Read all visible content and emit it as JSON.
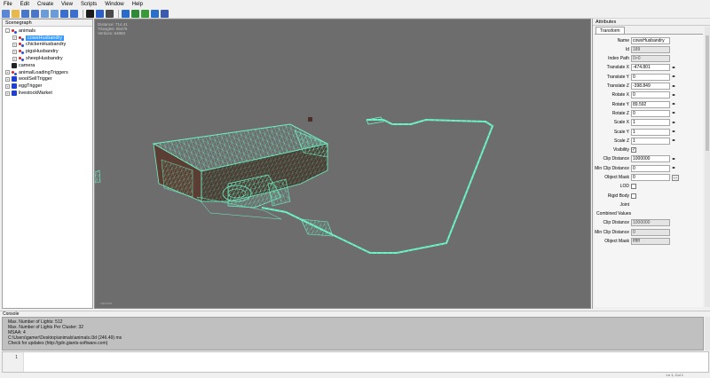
{
  "menu": [
    "File",
    "Edit",
    "Create",
    "View",
    "Scripts",
    "Window",
    "Help"
  ],
  "toolbar": {
    "icons": [
      "new-file-icon",
      "open-file-icon",
      "save-icon",
      "save-all-icon",
      "import-icon",
      "export-icon",
      "undo-icon",
      "redo-icon",
      "play-icon",
      "select-icon",
      "move-icon",
      "transform-icon",
      "terrain-icon",
      "grass-icon",
      "water-icon",
      "settings-icon"
    ],
    "colors": [
      "#5a86d6",
      "#e7b94c",
      "#4a76c8",
      "#4a76c8",
      "#6c9cd8",
      "#6c9cd8",
      "#3a6fd0",
      "#3a6fd0",
      "#1a1a1a",
      "#2a5fc8",
      "#4a4a4a",
      "#2a6ac8",
      "#2f8a3a",
      "#3a9a3a",
      "#2a70c8",
      "#3a5ab0"
    ]
  },
  "scenegraph": {
    "title": "Scenegraph",
    "items": [
      {
        "label": "animals",
        "depth": 0,
        "expander": "-",
        "icon": "transform-group-icon"
      },
      {
        "label": "cowsHusbandry",
        "depth": 1,
        "expander": "+",
        "icon": "transform-group-icon",
        "selected": true
      },
      {
        "label": "chickenHusbandry",
        "depth": 1,
        "expander": "+",
        "icon": "transform-group-icon"
      },
      {
        "label": "pigsHusbandry",
        "depth": 1,
        "expander": "+",
        "icon": "transform-group-icon"
      },
      {
        "label": "sheepHusbandry",
        "depth": 1,
        "expander": "+",
        "icon": "transform-group-icon"
      },
      {
        "label": "camera",
        "depth": 0,
        "expander": "",
        "icon": "camera-icon"
      },
      {
        "label": "animalLoadingTriggers",
        "depth": 0,
        "expander": "+",
        "icon": "transform-group-icon"
      },
      {
        "label": "woolSellTrigger",
        "depth": 0,
        "expander": "+",
        "icon": "trigger-icon"
      },
      {
        "label": "eggTrigger",
        "depth": 0,
        "expander": "+",
        "icon": "trigger-icon"
      },
      {
        "label": "livestockMarket",
        "depth": 0,
        "expander": "+",
        "icon": "trigger-icon"
      }
    ]
  },
  "viewport": {
    "stats": [
      "Distance: 714.41",
      "Triangles: 55475",
      "Vertices: 64883"
    ],
    "camera_label": "camera"
  },
  "attributes": {
    "title": "Attributes",
    "tab": "Transform",
    "fields": [
      {
        "label": "Name",
        "value": "cowsHusbandry",
        "kind": "text"
      },
      {
        "label": "Id",
        "value": "189",
        "kind": "readonly"
      },
      {
        "label": "Index Path",
        "value": "0>0",
        "kind": "readonly"
      },
      {
        "label": "Translate X",
        "value": "-474.801",
        "kind": "spin"
      },
      {
        "label": "Translate Y",
        "value": "0",
        "kind": "spin"
      },
      {
        "label": "Translate Z",
        "value": "-398.849",
        "kind": "spin"
      },
      {
        "label": "Rotate X",
        "value": "0",
        "kind": "spin"
      },
      {
        "label": "Rotate Y",
        "value": "89.592",
        "kind": "spin"
      },
      {
        "label": "Rotate Z",
        "value": "0",
        "kind": "spin"
      },
      {
        "label": "Scale X",
        "value": "1",
        "kind": "spin"
      },
      {
        "label": "Scale Y",
        "value": "1",
        "kind": "spin"
      },
      {
        "label": "Scale Z",
        "value": "1",
        "kind": "spin"
      },
      {
        "label": "Visibility",
        "value": "✓",
        "kind": "check"
      },
      {
        "label": "Clip Distance",
        "value": "1000000",
        "kind": "spin"
      },
      {
        "label": "Min Clip Distance",
        "value": "0",
        "kind": "spin"
      },
      {
        "label": "Object Mask",
        "value": "0",
        "kind": "browse"
      },
      {
        "label": "LOD",
        "value": "",
        "kind": "check"
      },
      {
        "label": "Rigid Body",
        "value": "",
        "kind": "check"
      },
      {
        "label": "Joint",
        "value": "",
        "kind": "label"
      }
    ],
    "combined_title": "Combined Values",
    "combined": [
      {
        "label": "Clip Distance",
        "value": "1000000"
      },
      {
        "label": "Min Clip Distance",
        "value": "0"
      },
      {
        "label": "Object Mask",
        "value": "ffffff"
      }
    ]
  },
  "console": {
    "title": "Console",
    "lines": [
      "Max. Number of Lights: 512",
      "Max. Number of Lights Per Cluster: 32",
      "MSAA: 4",
      "C:\\Users\\gamer\\Desktop\\animals\\animals.i3d (246.49) ms",
      "Check for updates (http://gdn.giants-software.com)"
    ]
  },
  "input": {
    "line_number": "1"
  },
  "status": "Ln 1, Col 1"
}
